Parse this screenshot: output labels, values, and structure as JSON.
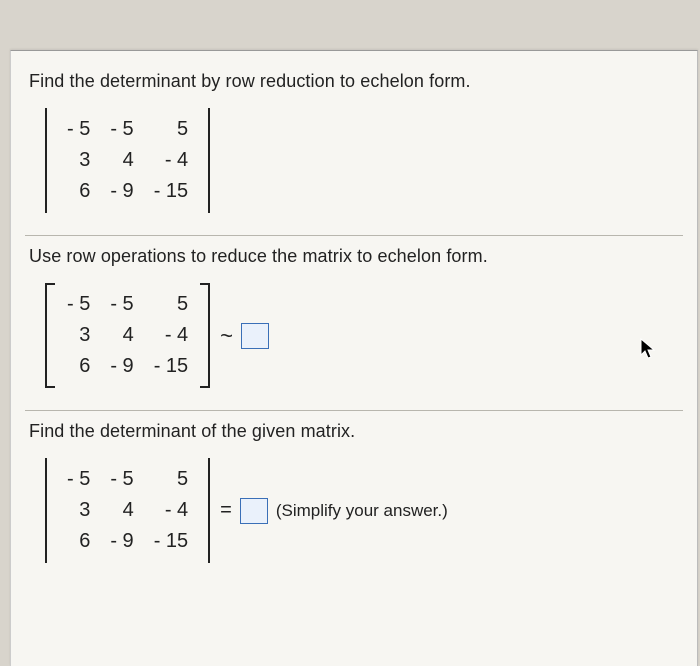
{
  "problem": {
    "title": "Find the determinant by row reduction to echelon form.",
    "matrix": {
      "r1": {
        "c1": "- 5",
        "c2": "- 5",
        "c3": "5"
      },
      "r2": {
        "c1": "3",
        "c2": "4",
        "c3": "- 4"
      },
      "r3": {
        "c1": "6",
        "c2": "- 9",
        "c3": "- 15"
      }
    }
  },
  "step1": {
    "prompt": "Use row operations to reduce the matrix to echelon form.",
    "matrix": {
      "r1": {
        "c1": "- 5",
        "c2": "- 5",
        "c3": "5"
      },
      "r2": {
        "c1": "3",
        "c2": "4",
        "c3": "- 4"
      },
      "r3": {
        "c1": "6",
        "c2": "- 9",
        "c3": "- 15"
      }
    },
    "tilde": "~"
  },
  "step2": {
    "prompt": "Find the determinant of the given matrix.",
    "matrix": {
      "r1": {
        "c1": "- 5",
        "c2": "- 5",
        "c3": "5"
      },
      "r2": {
        "c1": "3",
        "c2": "4",
        "c3": "- 4"
      },
      "r3": {
        "c1": "6",
        "c2": "- 9",
        "c3": "- 15"
      }
    },
    "equals": "=",
    "hint": "(Simplify your answer.)"
  }
}
